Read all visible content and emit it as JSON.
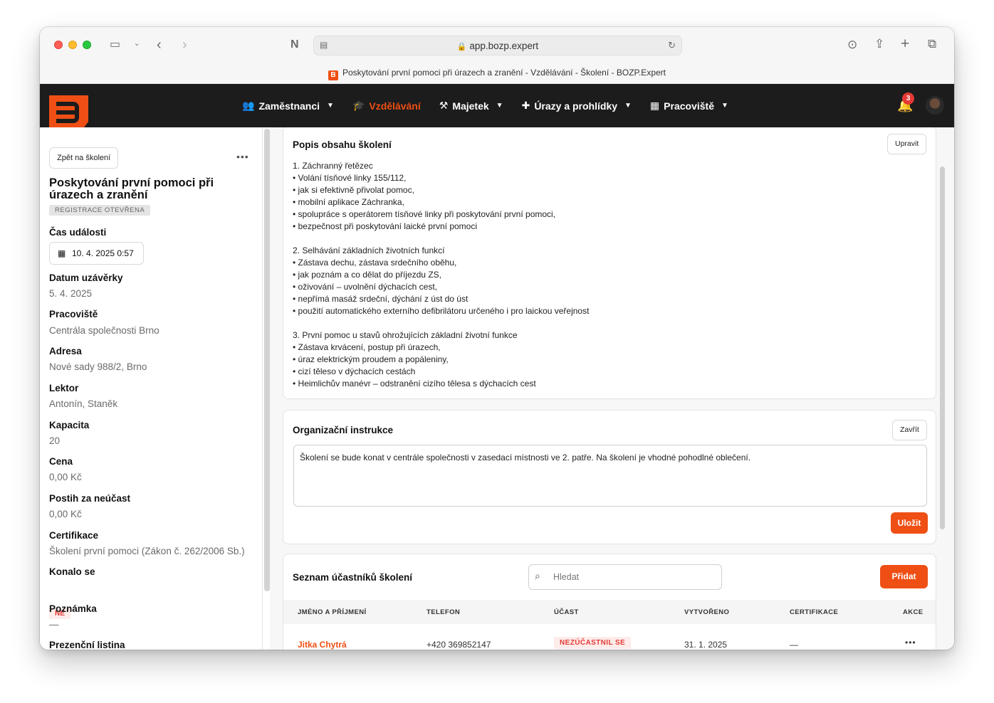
{
  "browser": {
    "url": "app.bozp.expert",
    "tab_title": "Poskytování první pomoci při úrazech a zranění - Vzdělávání - Školení - BOZP.Expert",
    "favicon_letter": "B"
  },
  "nav": {
    "items": [
      {
        "label": "Zaměstnanci",
        "icon": "users-icon"
      },
      {
        "label": "Vzdělávání",
        "icon": "graduation-cap-icon",
        "active": true
      },
      {
        "label": "Majetek",
        "icon": "hammer-icon"
      },
      {
        "label": "Úrazy a prohlídky",
        "icon": "medical-icon"
      },
      {
        "label": "Pracoviště",
        "icon": "building-icon"
      }
    ],
    "notification_count": "3"
  },
  "sidebar": {
    "back_label": "Zpět na školení",
    "more_label": "•••",
    "title": "Poskytování první pomoci při úrazech a zranění",
    "status_badge": "REGISTRACE OTEVŘENA",
    "fields": {
      "event_time_label": "Čas události",
      "event_time_value": "10. 4. 2025 0:57",
      "deadline_label": "Datum uzávěrky",
      "deadline_value": "5. 4. 2025",
      "workplace_label": "Pracoviště",
      "workplace_value": "Centrála společnosti Brno",
      "address_label": "Adresa",
      "address_value": "Nové sady 988/2, Brno",
      "lector_label": "Lektor",
      "lector_value": "Antonín, Staněk",
      "capacity_label": "Kapacita",
      "capacity_value": "20",
      "price_label": "Cena",
      "price_value": "0,00 Kč",
      "penalty_label": "Postih za neúčast",
      "penalty_value": "0,00 Kč",
      "cert_label": "Certifikace",
      "cert_value": "Školení první pomoci (Zákon č. 262/2006 Sb.)",
      "held_label": "Konalo se",
      "held_value": "NE",
      "note_label": "Poznámka",
      "note_value": "—",
      "attendance_label": "Prezenční listina"
    }
  },
  "content_card": {
    "title": "Popis obsahu školení",
    "edit_label": "Upravit",
    "lines": [
      "1. Záchranný řetězec",
      "• Volání tísňové linky 155/112,",
      "• jak si efektivně přivolat pomoc,",
      "• mobilní aplikace Záchranka,",
      "• spolupráce s operátorem tísňové linky při poskytování první pomoci,",
      "• bezpečnost při poskytování laické první pomoci",
      "",
      "2. Selhávání základních životních funkcí",
      "• Zástava dechu, zástava srdečního oběhu,",
      "• jak poznám a co dělat do příjezdu ZS,",
      "• oživování – uvolnění dýchacích cest,",
      "• nepřímá masáž srdeční, dýchání z úst do úst",
      "• použití automatického externího defibrilátoru určeného i pro laickou veřejnost",
      "",
      "3. První pomoc u stavů ohrožujících základní životní funkce",
      "• Zástava krvácení, postup při úrazech,",
      "• úraz elektrickým proudem a popáleniny,",
      "• cizí těleso v dýchacích cestách",
      "• Heimlichův manévr – odstranění cizího tělesa s dýchacích cest"
    ]
  },
  "instructions_card": {
    "title": "Organizační instrukce",
    "close_label": "Zavřít",
    "text": "Školení se bude konat v centrále společnosti v zasedací místnosti ve 2. patře. Na školení je vhodné pohodlné oblečení.",
    "save_label": "Uložit"
  },
  "participants_card": {
    "title": "Seznam účastníků školení",
    "search_placeholder": "Hledat",
    "add_label": "Přidat",
    "columns": [
      "JMÉNO A PŘÍJMENÍ",
      "TELEFON",
      "ÚČAST",
      "VYTVOŘENO",
      "CERTIFIKACE",
      "AKCE"
    ],
    "rows": [
      {
        "name": "Jitka Chytrá",
        "phone": "+420 369852147",
        "attendance": "NEZÚČASTNIL SE",
        "created": "31. 1. 2025",
        "certification": "—",
        "actions": "•••"
      }
    ]
  },
  "colors": {
    "accent": "#ef4f14",
    "appbar": "#1c1c1c",
    "danger": "#e53935"
  }
}
